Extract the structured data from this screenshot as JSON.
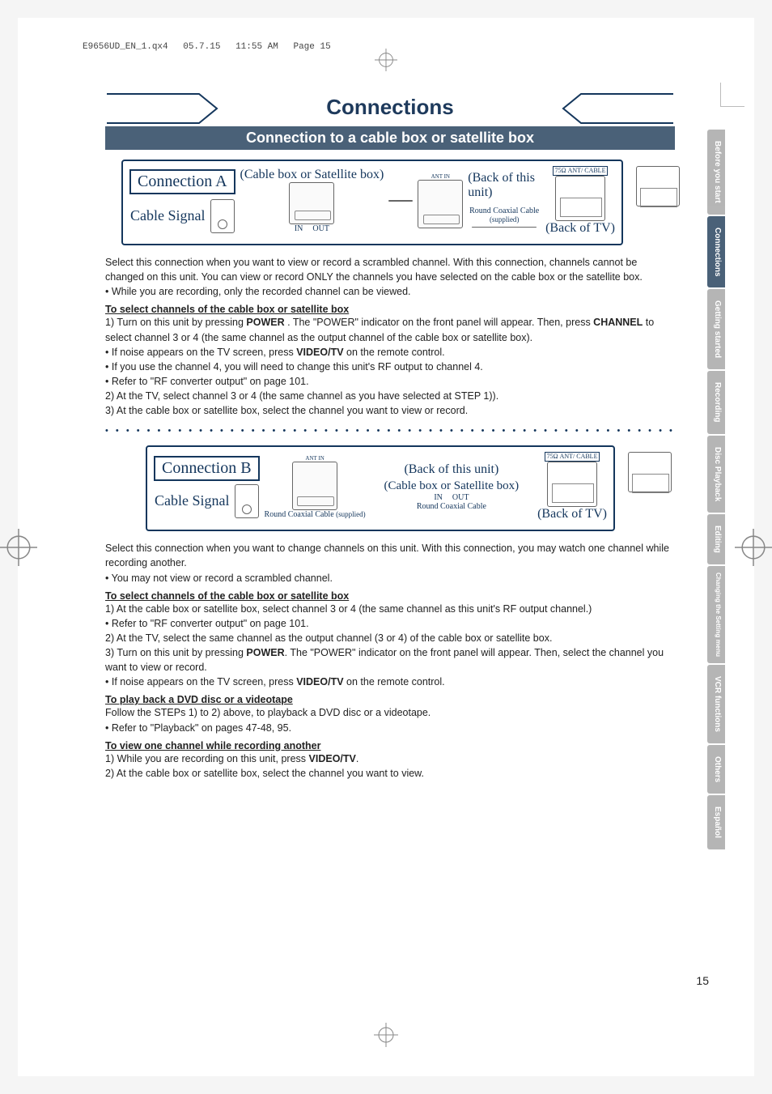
{
  "header": {
    "file": "E9656UD_EN_1.qx4",
    "date": "05.7.15",
    "time": "11:55 AM",
    "page_marker": "Page 15"
  },
  "title": "Connections",
  "section_heading": "Connection to a cable box or satellite box",
  "connA": {
    "label": "Connection A",
    "cable_signal": "Cable Signal",
    "cablebox": "(Cable  box or Satellite box)",
    "in": "IN",
    "out": "OUT",
    "ant_in": "ANT IN",
    "back_unit": "(Back of this unit)",
    "coax_label": "Round Coaxial Cable",
    "supplied": "(supplied)",
    "ant_marker": "75Ω ANT/ CABLE",
    "back_tv": "(Back of TV)"
  },
  "connA_text": {
    "p1": "Select this connection when you want to view or record a scrambled channel. With this connection, channels cannot be changed on this unit.  You can view or record ONLY the channels you have selected on the cable box or the satellite box.",
    "b1": "• While you are recording, only the recorded channel can be viewed.",
    "sub": "To select channels of the cable box or satellite box",
    "s1_pre": "1) Turn on this unit by pressing ",
    "s1_power": "POWER",
    "s1_mid": " . The \"POWER\" indicator on the front panel will appear.  Then, press ",
    "s1_channel": "CHANNEL",
    "s1_post": " to select channel 3 or 4 (the same channel as the output channel of the cable box or satellite box).",
    "s1a_pre": "  • If noise appears on the TV screen, press ",
    "s1a_vt": "VIDEO/TV",
    "s1a_post": " on the remote control.",
    "s1b": "  • If you use the channel 4, you will need to change this unit's RF output to channel 4.",
    "s1c": "  • Refer to \"RF converter output\" on page 101.",
    "s2": "2) At the TV, select channel 3 or 4 (the same channel as you have selected at STEP 1)).",
    "s3": "3) At the cable box or satellite box, select the channel you want to view or record."
  },
  "connB": {
    "label": "Connection B",
    "cable_signal": "Cable Signal",
    "ant_in": "ANT IN",
    "back_unit": "(Back of this unit)",
    "cablebox": "(Cable  box or Satellite box)",
    "in": "IN",
    "out": "OUT",
    "ant_marker": "75Ω ANT/ CABLE",
    "back_tv": "(Back of TV)",
    "coax1": "Round Coaxial Cable",
    "supplied1": "(supplied)",
    "coax2": "Round Coaxial Cable"
  },
  "connB_text": {
    "p1": "Select this connection when you want to change channels on this unit. With this connection, you may watch one channel while recording another.",
    "b1": "• You may not view or record a scrambled channel.",
    "sub1": "To select channels of the cable box or satellite box",
    "s1": "1) At the cable box or satellite box, select channel 3 or 4 (the same channel as this unit's RF output channel.)",
    "s1a": "  • Refer to \"RF converter output\" on page 101.",
    "s2": "2) At the TV, select the same channel as the output channel (3 or 4) of the cable box or satellite box.",
    "s3_pre": "3) Turn on this unit by pressing ",
    "s3_power": "POWER",
    "s3_post": ".  The \"POWER\" indicator on the front panel will appear. Then, select the channel you want to view or record.",
    "s3a_pre": "  • If noise appears on the TV screen, press ",
    "s3a_vt": "VIDEO/TV",
    "s3a_post": " on the remote control.",
    "sub2": "To play back a DVD disc or a videotape",
    "p2": "Follow the STEPs 1) to 2) above, to playback a DVD disc or a videotape.",
    "p2a": "  • Refer to \"Playback\" on pages 47-48, 95.",
    "sub3": "To view one channel while recording another",
    "r1_pre": "1) While you are recording on this unit, press ",
    "r1_vt": "VIDEO/TV",
    "r1_post": ".",
    "r2": "2) At the cable box or satellite box, select the channel you want to view."
  },
  "tabs": {
    "t1": "Before you start",
    "t2": "Connections",
    "t3": "Getting started",
    "t4": "Recording",
    "t5": "Disc Playback",
    "t6": "Editing",
    "t7": "Changing the Setting menu",
    "t8": "VCR functions",
    "t9": "Others",
    "t10": "Español"
  },
  "page_number": "15"
}
